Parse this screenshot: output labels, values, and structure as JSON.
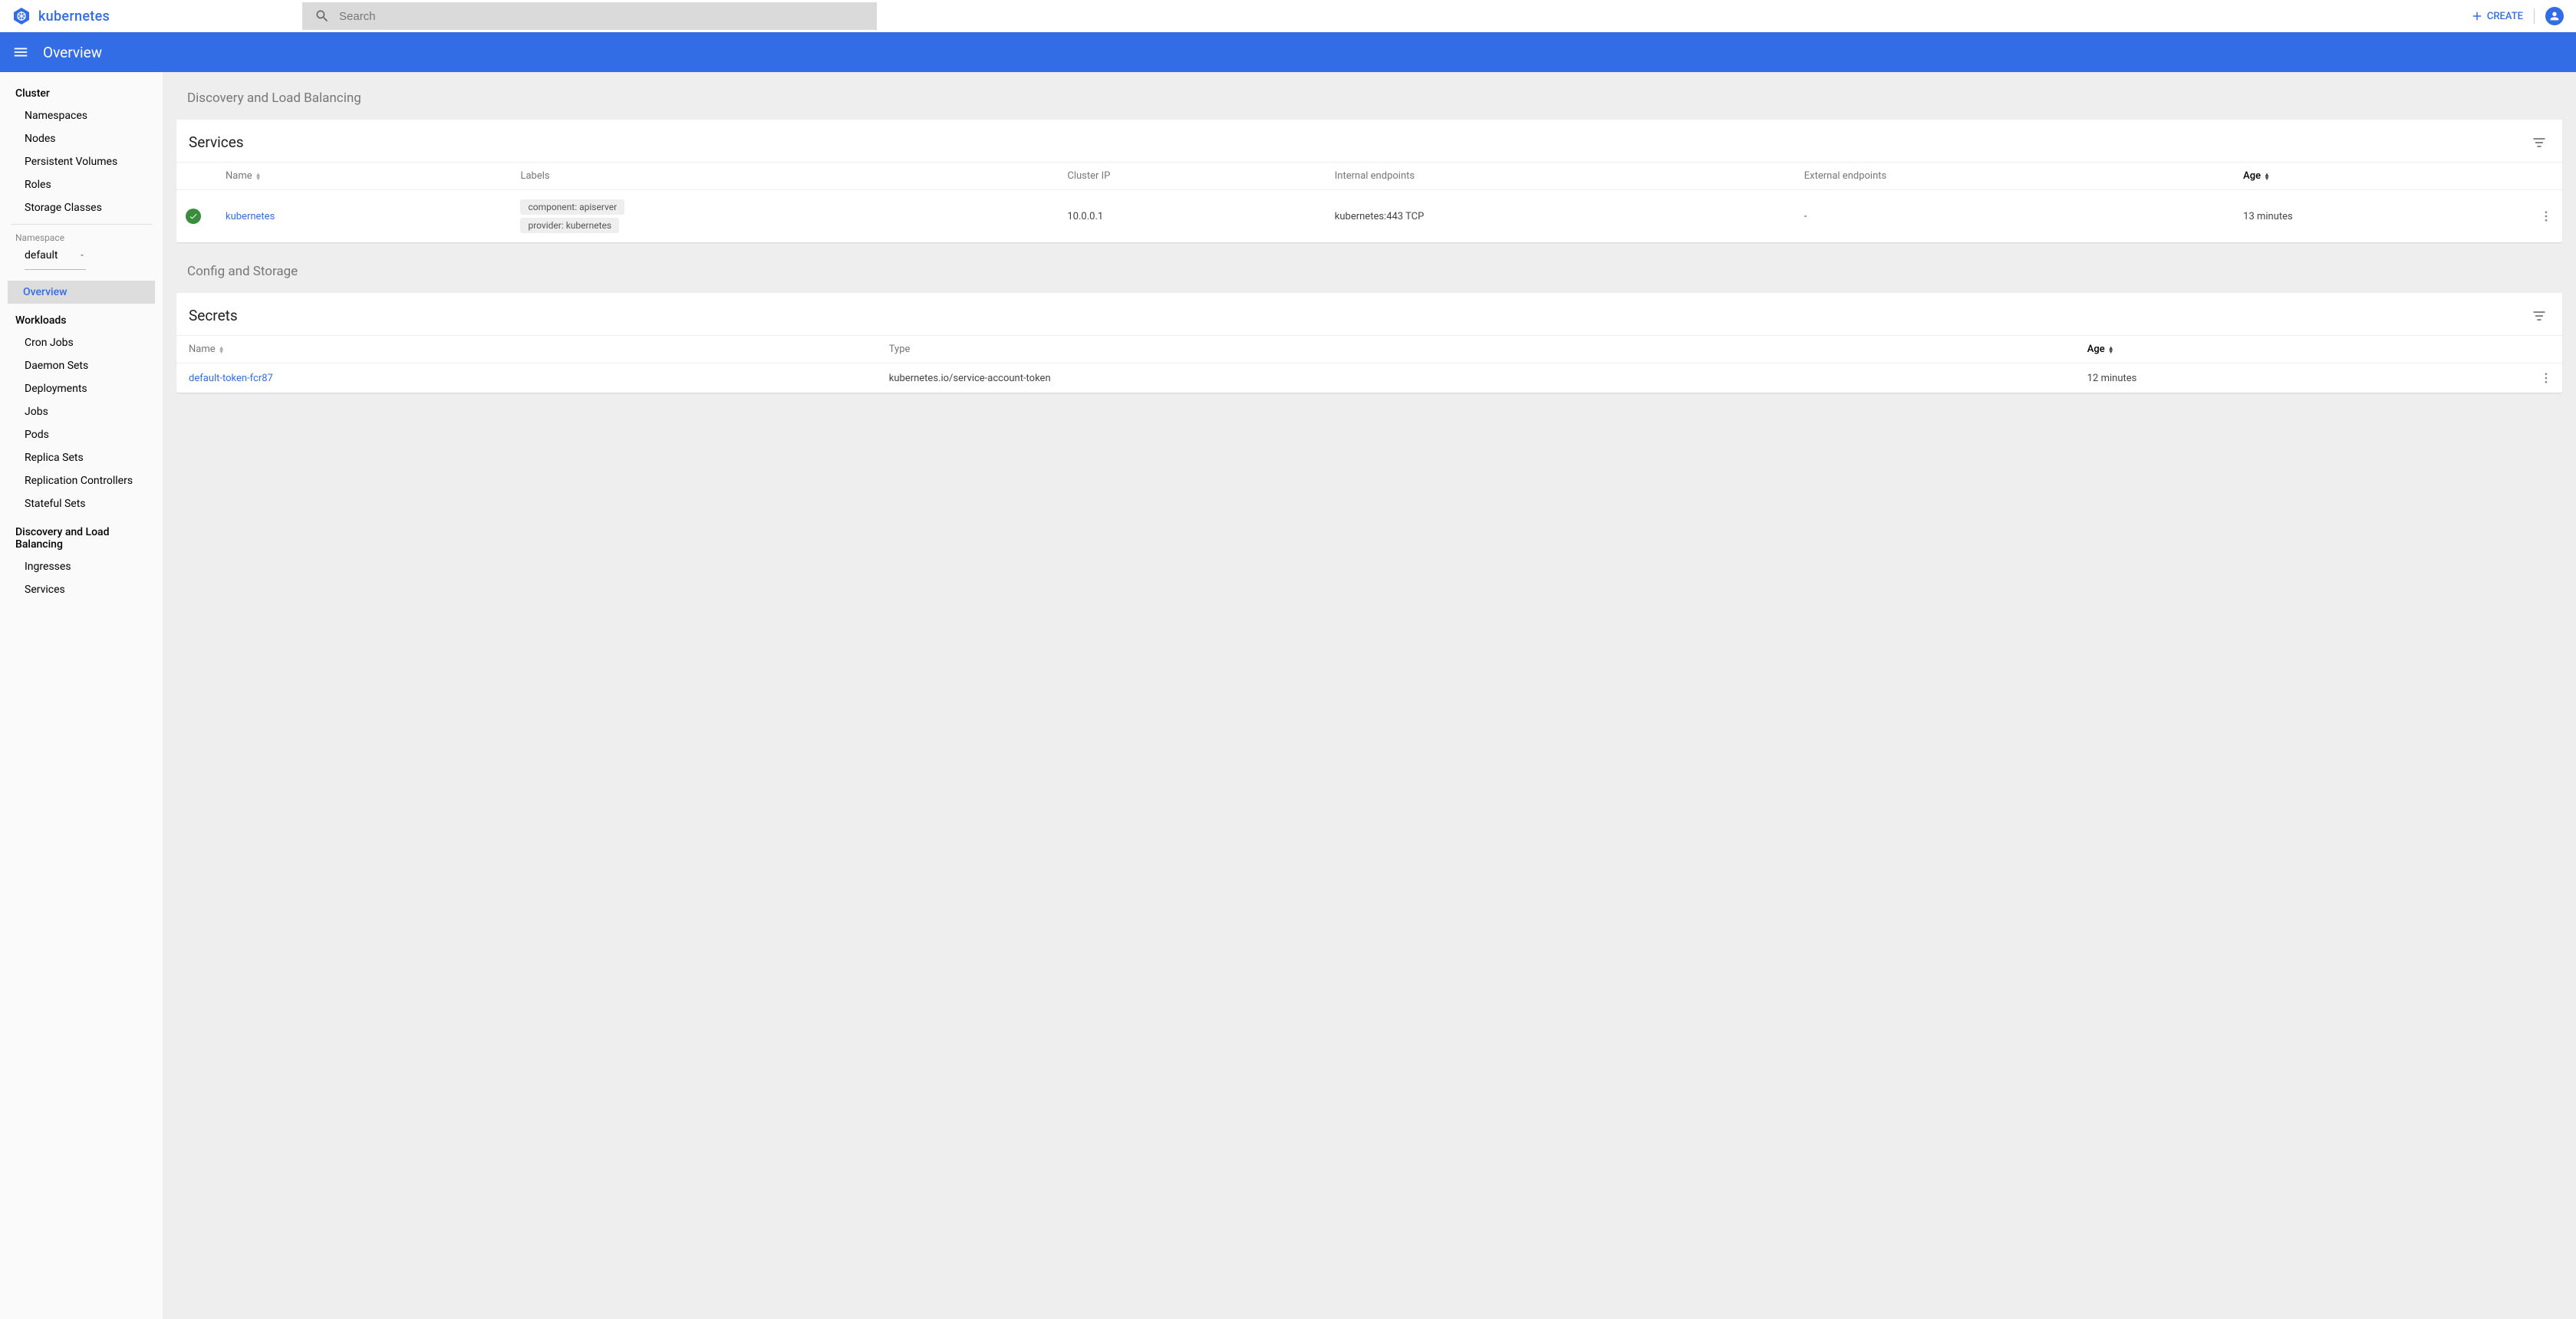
{
  "brand": {
    "name": "kubernetes"
  },
  "search": {
    "placeholder": "Search"
  },
  "header": {
    "create_label": "CREATE"
  },
  "titlebar": {
    "title": "Overview"
  },
  "sidebar": {
    "cluster_heading": "Cluster",
    "cluster_items": [
      "Namespaces",
      "Nodes",
      "Persistent Volumes",
      "Roles",
      "Storage Classes"
    ],
    "namespace_label": "Namespace",
    "namespace_value": "default",
    "overview_label": "Overview",
    "workloads_heading": "Workloads",
    "workloads_items": [
      "Cron Jobs",
      "Daemon Sets",
      "Deployments",
      "Jobs",
      "Pods",
      "Replica Sets",
      "Replication Controllers",
      "Stateful Sets"
    ],
    "dlb_heading": "Discovery and Load Balancing",
    "dlb_items": [
      "Ingresses",
      "Services"
    ]
  },
  "sections": {
    "dlb_title": "Discovery and Load Balancing",
    "cfg_title": "Config and Storage"
  },
  "services": {
    "card_title": "Services",
    "columns": {
      "name": "Name",
      "labels": "Labels",
      "cluster_ip": "Cluster IP",
      "internal_ep": "Internal endpoints",
      "external_ep": "External endpoints",
      "age": "Age"
    },
    "rows": [
      {
        "name": "kubernetes",
        "labels": [
          "component: apiserver",
          "provider: kubernetes"
        ],
        "cluster_ip": "10.0.0.1",
        "internal_ep": "kubernetes:443 TCP",
        "external_ep": "-",
        "age": "13 minutes"
      }
    ]
  },
  "secrets": {
    "card_title": "Secrets",
    "columns": {
      "name": "Name",
      "type": "Type",
      "age": "Age"
    },
    "rows": [
      {
        "name": "default-token-fcr87",
        "type": "kubernetes.io/service-account-token",
        "age": "12 minutes"
      }
    ]
  }
}
